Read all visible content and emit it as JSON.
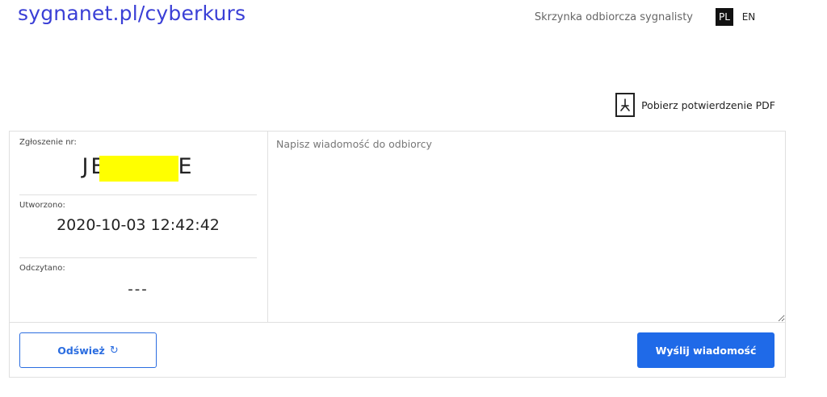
{
  "header": {
    "logo": "sygnanet.pl/cyberkurs",
    "inbox_link": "Skrzynka odbiorcza sygnalisty",
    "languages": [
      "PL",
      "EN"
    ],
    "active_language": "PL"
  },
  "pdf_link": "Pobierz potwierdzenie PDF",
  "report": {
    "number_label": "Zgłoszenie nr:",
    "number_left": "JE",
    "number_right": "E",
    "created_label": "Utworzono:",
    "created_value": "2020-10-03 12:42:42",
    "read_label": "Odczytano:",
    "read_value": "---"
  },
  "message": {
    "placeholder": "Napisz wiadomość do odbiorcy"
  },
  "buttons": {
    "refresh": "Odśwież",
    "send": "Wyślij wiadomość"
  },
  "colors": {
    "accent": "#1f6ae8",
    "logo": "#3a3fd6",
    "redaction": "#ffff00"
  }
}
